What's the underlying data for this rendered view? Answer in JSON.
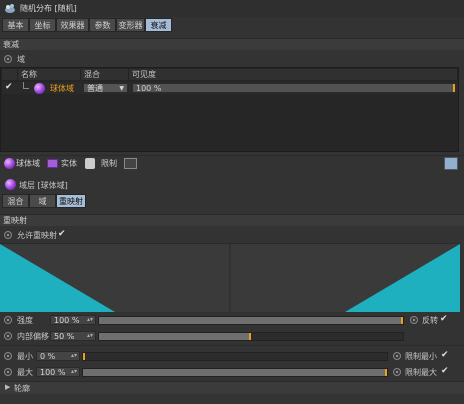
{
  "window": {
    "title": "随机分布 [随机]"
  },
  "tabs": [
    {
      "label": "基本",
      "active": false
    },
    {
      "label": "坐标",
      "active": false
    },
    {
      "label": "效果器",
      "active": false
    },
    {
      "label": "参数",
      "active": false
    },
    {
      "label": "变形器",
      "active": false
    },
    {
      "label": "衰减",
      "active": true
    }
  ],
  "falloff_section": {
    "title": "衰减",
    "field_label": "域"
  },
  "table": {
    "headers": [
      "名称",
      "混合",
      "可见度"
    ],
    "rows": [
      {
        "checked": true,
        "name": "球体域",
        "blend": "普通",
        "visibility": "100 %"
      }
    ]
  },
  "toolbar": {
    "sphere_label": "球体域",
    "solid_label": "实体",
    "limit_label": "限制"
  },
  "layer": {
    "title": "域层 [球体域]"
  },
  "subtabs": [
    {
      "label": "混合",
      "active": false
    },
    {
      "label": "域",
      "active": false
    },
    {
      "label": "重映射",
      "active": true
    }
  ],
  "remap": {
    "section_title": "重映射",
    "enable_label": "允许重映射",
    "enable_checked": true,
    "curve_color": "#1fb0c0",
    "strength_label": "强度",
    "strength_value": "100 %",
    "strength_fraction": 1.0,
    "invert_label": "反转",
    "invert_checked": true,
    "inner_offset_label": "内部偏移",
    "inner_offset_value": "50 %",
    "inner_offset_fraction": 0.5,
    "min_label": "最小",
    "min_value": "0 %",
    "min_fraction": 0.0,
    "clamp_min_label": "限制最小",
    "clamp_min_checked": true,
    "max_label": "最大",
    "max_value": "100 %",
    "max_fraction": 1.0,
    "clamp_max_label": "限制最大",
    "clamp_max_checked": true,
    "outline_label": "轮廓"
  },
  "colors": {
    "accent": "#a4bcd6",
    "knob": "#e8a020",
    "curve": "#1fb0c0"
  }
}
